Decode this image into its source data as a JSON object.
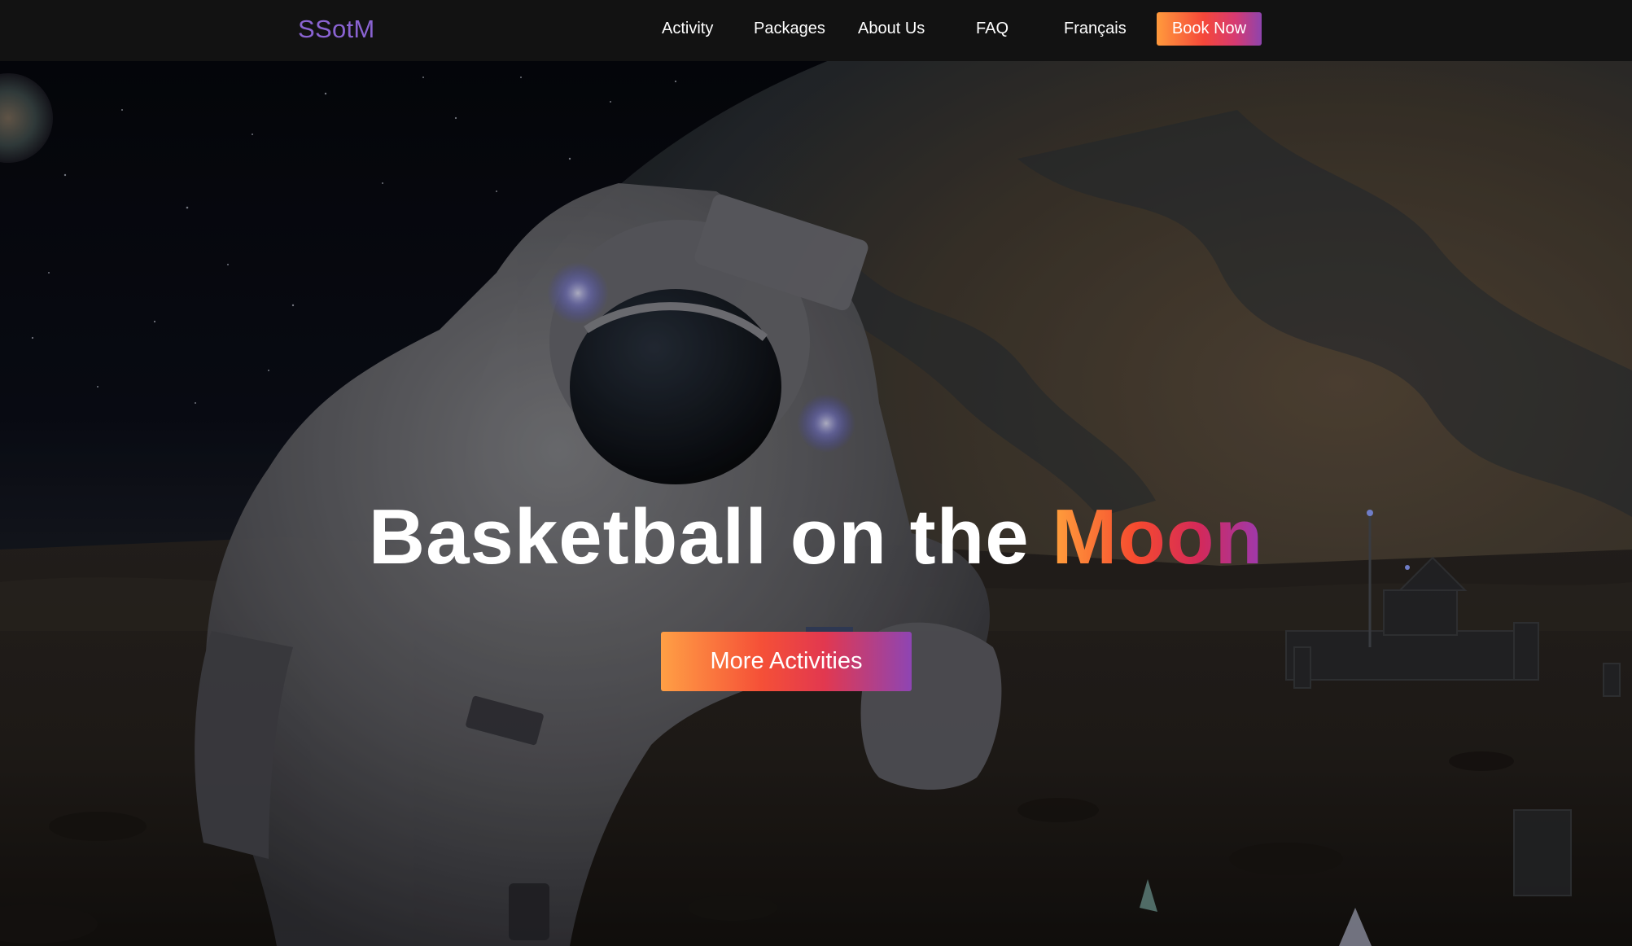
{
  "navbar": {
    "logo": "SSotM",
    "links": [
      "Activity",
      "Packages",
      "About Us",
      "FAQ",
      "Français"
    ],
    "cta": "Book Now"
  },
  "hero": {
    "title_main": "Basketball on the ",
    "title_accent": "Moon",
    "button": "More Activities"
  },
  "colors": {
    "logo": "#8a63d2",
    "gradient_start": "#ff9a3c",
    "gradient_mid": "#f5473a",
    "gradient_end": "#8e44ad",
    "navbar_bg": "#121212"
  }
}
